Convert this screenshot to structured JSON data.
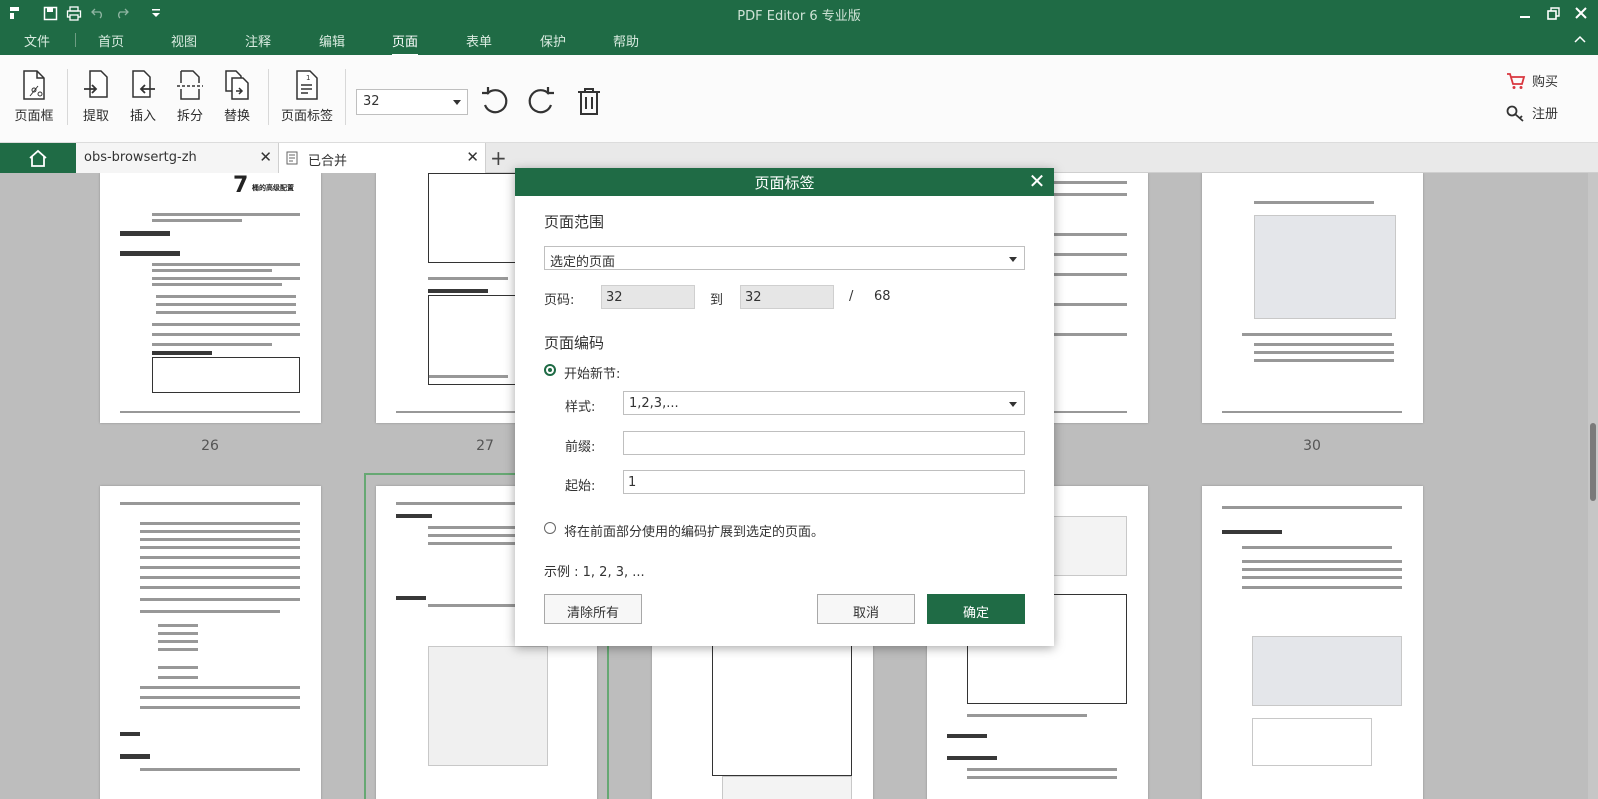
{
  "app": {
    "title": "PDF Editor 6 专业版",
    "quick_access": [
      "app-menu-icon",
      "save-icon",
      "print-icon",
      "undo-icon",
      "redo-icon",
      "customize-icon"
    ],
    "window_controls": [
      "minimize-icon",
      "restore-icon",
      "close-icon"
    ]
  },
  "menu": {
    "items": [
      "文件",
      "首页",
      "视图",
      "注释",
      "编辑",
      "页面",
      "表单",
      "保护",
      "帮助"
    ],
    "active": "页面"
  },
  "ribbon": {
    "buttons": [
      "页面框",
      "提取",
      "插入",
      "拆分",
      "替换",
      "页面标签"
    ],
    "page_select_value": "32",
    "tools": [
      "rotate-left-icon",
      "rotate-right-icon",
      "delete-icon"
    ],
    "buy_label": "购买",
    "register_label": "注册"
  },
  "tabs": [
    {
      "label": "obs-browsertg-zh"
    },
    {
      "label": "已合并"
    }
  ],
  "thumbnails": {
    "page_numbers": [
      "26",
      "27",
      "30"
    ],
    "heading_page26": "7",
    "heading_page26_title": "桶的高级配置"
  },
  "dialog": {
    "title": "页面标签",
    "page_range_heading": "页面范围",
    "range_select_value": "选定的页面",
    "page_label": "页码:",
    "from_value": "32",
    "to_label": "到",
    "to_value": "32",
    "slash": "/",
    "total_pages": "68",
    "numbering_heading": "页面编码",
    "start_new_section_label": "开始新节:",
    "style_label": "样式:",
    "style_value": "1,2,3,...",
    "prefix_label": "前缀:",
    "prefix_value": "",
    "start_label": "起始:",
    "start_value": "1",
    "extend_label": "将在前面部分使用的编码扩展到选定的页面。",
    "example_text": "示例 : 1, 2, 3, ...",
    "clear_all_label": "清除所有",
    "cancel_label": "取消",
    "ok_label": "确定"
  },
  "colors": {
    "brand_green": "#1f6b45",
    "workspace_gray": "#bdbdbd",
    "cart_red": "#d9363e"
  }
}
